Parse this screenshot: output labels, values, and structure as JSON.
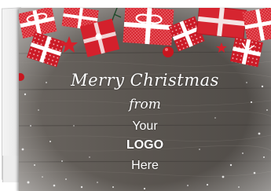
{
  "card": {
    "line1": "Merry Christmas",
    "line2": "from",
    "line3": "Your",
    "line4": "LOGO",
    "line5": "Here"
  },
  "colors": {
    "wood": "#5b5650",
    "gift_red": "#d4202c",
    "ribbon": "#ffffff",
    "snow": "#f2f2f2",
    "text": "#ffffff"
  }
}
